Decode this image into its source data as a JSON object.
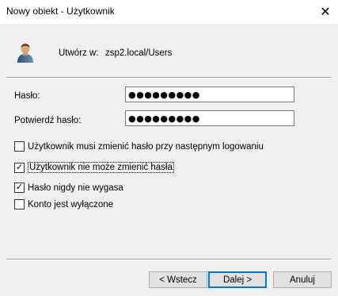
{
  "window": {
    "title": "Nowy obiekt - Użytkownik",
    "close_glyph": "✕"
  },
  "header": {
    "icon": "user-icon",
    "create_label": "Utwórz w:",
    "create_value": "zsp2.local/Users"
  },
  "form": {
    "password_label": "Hasło:",
    "password_value": "●●●●●●●●●",
    "confirm_label": "Potwierdź hasło:",
    "confirm_value": "●●●●●●●●●"
  },
  "options": [
    {
      "label": "Użytkownik musi zmienić hasło przy następnym logowaniu",
      "checked": false
    },
    {
      "label": "Użytkownik nie może zmienić hasła",
      "checked": true
    },
    {
      "label": "Hasło nigdy nie wygasa",
      "checked": true
    },
    {
      "label": "Konto jest wyłączone",
      "checked": false
    }
  ],
  "check_glyph": "✓",
  "buttons": {
    "back": "< Wstecz",
    "next": "Dalej >",
    "cancel": "Anuluj"
  },
  "colors": {
    "accent": "#0078d7",
    "window_bg": "#f0f0f0"
  }
}
